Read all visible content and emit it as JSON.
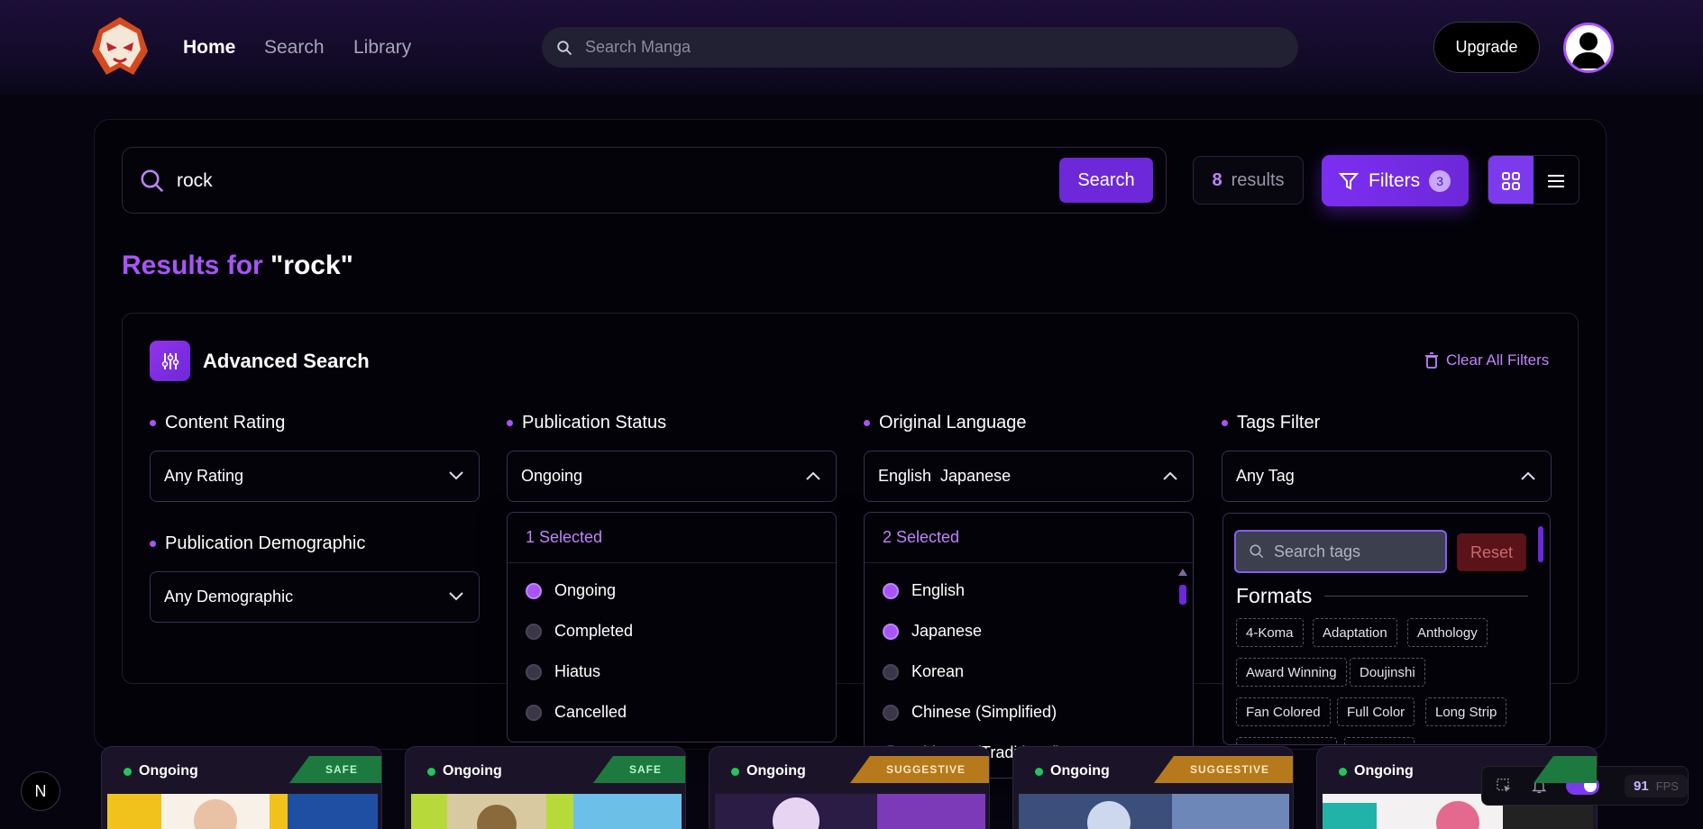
{
  "nav": {
    "home": "Home",
    "search": "Search",
    "library": "Library"
  },
  "topsearch": {
    "placeholder": "Search Manga"
  },
  "header": {
    "upgrade": "Upgrade"
  },
  "search": {
    "query": "rock",
    "button": "Search",
    "result_count": "8",
    "results_label": "results",
    "filters_label": "Filters",
    "filters_count": "3"
  },
  "results_title": {
    "prefix": "Results for",
    "query": "\"rock\""
  },
  "advanced": {
    "title": "Advanced Search",
    "clear": "Clear All Filters",
    "content_rating": {
      "label": "Content Rating",
      "value": "Any Rating"
    },
    "demographic": {
      "label": "Publication Demographic",
      "value": "Any Demographic"
    },
    "status": {
      "label": "Publication Status",
      "value": "Ongoing",
      "selected": "1 Selected",
      "options": [
        {
          "label": "Ongoing",
          "checked": true
        },
        {
          "label": "Completed",
          "checked": false
        },
        {
          "label": "Hiatus",
          "checked": false
        },
        {
          "label": "Cancelled",
          "checked": false
        }
      ]
    },
    "language": {
      "label": "Original Language",
      "value": "English  Japanese",
      "selected": "2 Selected",
      "options": [
        {
          "label": "English",
          "checked": true
        },
        {
          "label": "Japanese",
          "checked": true
        },
        {
          "label": "Korean",
          "checked": false
        },
        {
          "label": "Chinese (Simplified)",
          "checked": false
        },
        {
          "label": "Chinese (Traditional)",
          "checked": false
        }
      ]
    },
    "tags": {
      "label": "Tags Filter",
      "value": "Any Tag",
      "search_placeholder": "Search tags",
      "reset": "Reset",
      "section": "Formats",
      "items": [
        "4-Koma",
        "Adaptation",
        "Anthology",
        "Award Winning",
        "Doujinshi",
        "Fan Colored",
        "Full Color",
        "Long Strip"
      ]
    }
  },
  "cards": [
    {
      "status": "Ongoing",
      "badge": "SAFE",
      "badge_type": "safe"
    },
    {
      "status": "Ongoing",
      "badge": "SAFE",
      "badge_type": "safe"
    },
    {
      "status": "Ongoing",
      "badge": "SUGGESTIVE",
      "badge_type": "sugg"
    },
    {
      "status": "Ongoing",
      "badge": "SUGGESTIVE",
      "badge_type": "sugg"
    },
    {
      "status": "Ongoing",
      "badge": "",
      "badge_type": "safe"
    }
  ],
  "dev": {
    "next_badge": "N",
    "fps_value": "91",
    "fps_label": "FPS"
  },
  "colors": {
    "accent": "#a855f7",
    "primary": "#6d28d9",
    "safe": "#1c7a3f",
    "suggestive": "#b6791c"
  }
}
